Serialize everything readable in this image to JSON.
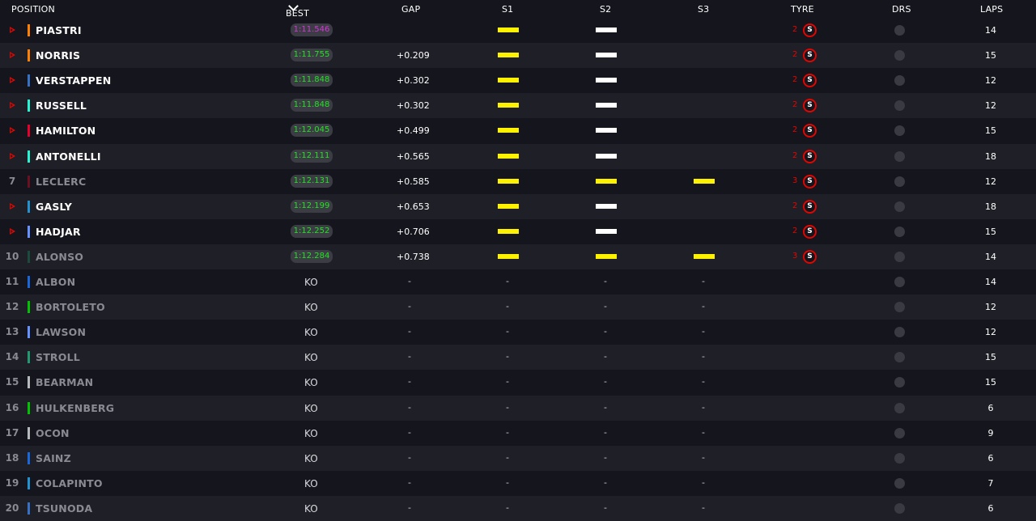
{
  "header": {
    "position": "POSITION",
    "best_lap": "BEST LAP",
    "gap": "GAP",
    "s1": "S1",
    "s2": "S2",
    "s3": "S3",
    "tyre": "TYRE",
    "drs": "DRS",
    "laps": "LAPS"
  },
  "colors": {
    "improved_arrow": "#e10600",
    "fastest_lap": "#d237d6",
    "personal_best": "#22e322",
    "sector_yellow": "#fff200",
    "sector_white": "#ffffff",
    "soft_tyre": "#e10600"
  },
  "rows": [
    {
      "pos": "",
      "improved": true,
      "name": "PIASTRI",
      "team_color": "#ff8000",
      "best_lap": "1:11.546",
      "lap_style": "purple",
      "gap": "",
      "s1": "yellow",
      "s2": "white",
      "s3": "",
      "tyre_age": "2",
      "tyre": "S",
      "laps": "14",
      "out": false
    },
    {
      "pos": "",
      "improved": true,
      "name": "NORRIS",
      "team_color": "#ff8000",
      "best_lap": "1:11.755",
      "lap_style": "green",
      "gap": "+0.209",
      "s1": "yellow",
      "s2": "white",
      "s3": "",
      "tyre_age": "2",
      "tyre": "S",
      "laps": "15",
      "out": false
    },
    {
      "pos": "",
      "improved": true,
      "name": "VERSTAPPEN",
      "team_color": "#3671c6",
      "best_lap": "1:11.848",
      "lap_style": "green",
      "gap": "+0.302",
      "s1": "yellow",
      "s2": "white",
      "s3": "",
      "tyre_age": "2",
      "tyre": "S",
      "laps": "12",
      "out": false
    },
    {
      "pos": "",
      "improved": true,
      "name": "RUSSELL",
      "team_color": "#27f4d2",
      "best_lap": "1:11.848",
      "lap_style": "green",
      "gap": "+0.302",
      "s1": "yellow",
      "s2": "white",
      "s3": "",
      "tyre_age": "2",
      "tyre": "S",
      "laps": "12",
      "out": false
    },
    {
      "pos": "",
      "improved": true,
      "name": "HAMILTON",
      "team_color": "#e8002d",
      "best_lap": "1:12.045",
      "lap_style": "green",
      "gap": "+0.499",
      "s1": "yellow",
      "s2": "white",
      "s3": "",
      "tyre_age": "2",
      "tyre": "S",
      "laps": "15",
      "out": false
    },
    {
      "pos": "",
      "improved": true,
      "name": "ANTONELLI",
      "team_color": "#27f4d2",
      "best_lap": "1:12.111",
      "lap_style": "green",
      "gap": "+0.565",
      "s1": "yellow",
      "s2": "white",
      "s3": "",
      "tyre_age": "2",
      "tyre": "S",
      "laps": "18",
      "out": false
    },
    {
      "pos": "7",
      "improved": false,
      "name": "LECLERC",
      "team_color": "#6a1020",
      "best_lap": "1:12.131",
      "lap_style": "green",
      "gap": "+0.585",
      "s1": "yellow",
      "s2": "yellow",
      "s3": "yellow",
      "tyre_age": "3",
      "tyre": "S",
      "laps": "12",
      "out": true
    },
    {
      "pos": "",
      "improved": true,
      "name": "GASLY",
      "team_color": "#2293d1",
      "best_lap": "1:12.199",
      "lap_style": "green",
      "gap": "+0.653",
      "s1": "yellow",
      "s2": "white",
      "s3": "",
      "tyre_age": "2",
      "tyre": "S",
      "laps": "18",
      "out": false
    },
    {
      "pos": "",
      "improved": true,
      "name": "HADJAR",
      "team_color": "#6692ff",
      "best_lap": "1:12.252",
      "lap_style": "green",
      "gap": "+0.706",
      "s1": "yellow",
      "s2": "white",
      "s3": "",
      "tyre_age": "2",
      "tyre": "S",
      "laps": "15",
      "out": false
    },
    {
      "pos": "10",
      "improved": false,
      "name": "ALONSO",
      "team_color": "#1c4a3c",
      "best_lap": "1:12.284",
      "lap_style": "green",
      "gap": "+0.738",
      "s1": "yellow",
      "s2": "yellow",
      "s3": "yellow",
      "tyre_age": "3",
      "tyre": "S",
      "laps": "14",
      "out": true
    },
    {
      "pos": "11",
      "improved": false,
      "name": "ALBON",
      "team_color": "#1868db",
      "ko": "KO",
      "dash": "-",
      "laps": "14",
      "out": true
    },
    {
      "pos": "12",
      "improved": false,
      "name": "BORTOLETO",
      "team_color": "#00c400",
      "ko": "KO",
      "dash": "-",
      "laps": "12",
      "out": true
    },
    {
      "pos": "13",
      "improved": false,
      "name": "LAWSON",
      "team_color": "#6692ff",
      "ko": "KO",
      "dash": "-",
      "laps": "12",
      "out": true
    },
    {
      "pos": "14",
      "improved": false,
      "name": "STROLL",
      "team_color": "#229971",
      "ko": "KO",
      "dash": "-",
      "laps": "15",
      "out": true
    },
    {
      "pos": "15",
      "improved": false,
      "name": "BEARMAN",
      "team_color": "#b6babd",
      "ko": "KO",
      "dash": "-",
      "laps": "15",
      "out": true
    },
    {
      "pos": "16",
      "improved": false,
      "name": "HULKENBERG",
      "team_color": "#00c400",
      "ko": "KO",
      "dash": "-",
      "laps": "6",
      "out": true
    },
    {
      "pos": "17",
      "improved": false,
      "name": "OCON",
      "team_color": "#b6babd",
      "ko": "KO",
      "dash": "-",
      "laps": "9",
      "out": true
    },
    {
      "pos": "18",
      "improved": false,
      "name": "SAINZ",
      "team_color": "#1868db",
      "ko": "KO",
      "dash": "-",
      "laps": "6",
      "out": true
    },
    {
      "pos": "19",
      "improved": false,
      "name": "COLAPINTO",
      "team_color": "#2293d1",
      "ko": "KO",
      "dash": "-",
      "laps": "7",
      "out": true
    },
    {
      "pos": "20",
      "improved": false,
      "name": "TSUNODA",
      "team_color": "#3671c6",
      "ko": "KO",
      "dash": "-",
      "laps": "6",
      "out": true
    }
  ]
}
